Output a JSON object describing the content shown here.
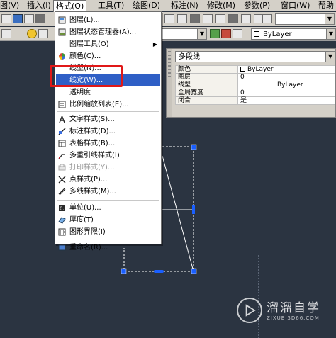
{
  "menubar": {
    "items": [
      "图(V)",
      "插入(I)",
      "格式(O)",
      "工具(T)",
      "绘图(D)",
      "标注(N)",
      "修改(M)",
      "参数(P)",
      "窗口(W)",
      "帮助"
    ]
  },
  "toolbar": {
    "color_combo": "ByLayer"
  },
  "format_menu": {
    "items": [
      {
        "label": "图层(L)...",
        "icon": "layers-icon"
      },
      {
        "label": "图层状态管理器(A)...",
        "icon": "layer-state-icon"
      },
      {
        "label": "图层工具(O)",
        "icon": "",
        "submenu": "▶"
      },
      {
        "label": "颜色(C)...",
        "icon": "color-wheel-icon"
      },
      {
        "label": "线型(N)...",
        "icon": ""
      },
      {
        "label": "线宽(W)...",
        "icon": ""
      },
      {
        "label": "透明度",
        "icon": ""
      },
      {
        "label": "比例缩放列表(E)...",
        "icon": "scale-list-icon"
      },
      {
        "label": "文字样式(S)...",
        "icon": "text-style-icon"
      },
      {
        "label": "标注样式(D)...",
        "icon": "dim-style-icon"
      },
      {
        "label": "表格样式(B)...",
        "icon": "table-style-icon"
      },
      {
        "label": "多重引线样式(I)",
        "icon": "mleader-style-icon"
      },
      {
        "label": "打印样式(Y)...",
        "icon": "plot-style-icon"
      },
      {
        "label": "点样式(P)...",
        "icon": "point-style-icon"
      },
      {
        "label": "多线样式(M)...",
        "icon": "mline-style-icon"
      },
      {
        "label": "单位(U)...",
        "icon": "units-icon"
      },
      {
        "label": "厚度(T)",
        "icon": "thickness-icon"
      },
      {
        "label": "图形界限(I)",
        "icon": "limits-icon"
      },
      {
        "label": "重命名(R)...",
        "icon": "rename-icon"
      }
    ]
  },
  "properties": {
    "object_type": "多段线",
    "rows": [
      {
        "key": "颜色",
        "value": "ByLayer"
      },
      {
        "key": "图层",
        "value": "0"
      },
      {
        "key": "线型",
        "value": "ByLayer"
      },
      {
        "key": "全局宽度",
        "value": "0"
      },
      {
        "key": "闭合",
        "value": "是"
      }
    ]
  },
  "watermark": {
    "title": "溜溜自学",
    "subtitle": "ZIXUE.3D66.COM"
  },
  "colors": {
    "canvas": "#2b3441",
    "menu_highlight": "#2f5fc6",
    "callout_red": "#e01818",
    "grip_blue": "#1a5fff"
  }
}
